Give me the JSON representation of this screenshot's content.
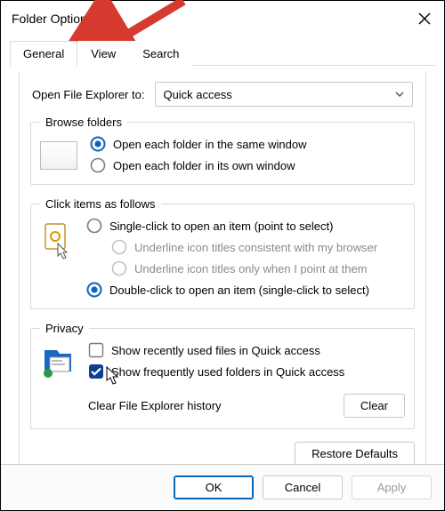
{
  "window": {
    "title": "Folder Options"
  },
  "tabs": {
    "general": "General",
    "view": "View",
    "search": "Search"
  },
  "open_explorer": {
    "label": "Open File Explorer to:",
    "value": "Quick access"
  },
  "browse": {
    "legend": "Browse folders",
    "same": "Open each folder in the same window",
    "own": "Open each folder in its own window"
  },
  "click": {
    "legend": "Click items as follows",
    "single": "Single-click to open an item (point to select)",
    "u1": "Underline icon titles consistent with my browser",
    "u2": "Underline icon titles only when I point at them",
    "double": "Double-click to open an item (single-click to select)"
  },
  "privacy": {
    "legend": "Privacy",
    "files": "Show recently used files in Quick access",
    "folders": "Show frequently used folders in Quick access",
    "history_label": "Clear File Explorer history",
    "clear": "Clear"
  },
  "restore": "Restore Defaults",
  "footer": {
    "ok": "OK",
    "cancel": "Cancel",
    "apply": "Apply"
  }
}
